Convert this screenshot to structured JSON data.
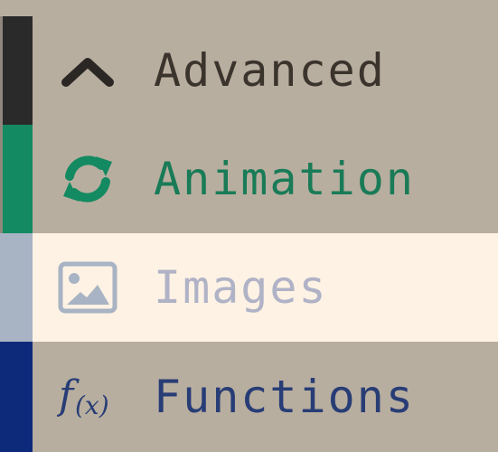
{
  "menu": {
    "items": [
      {
        "label": "Advanced",
        "icon": "chevron-up-icon",
        "accent_color": "#2a2a2a",
        "text_color": "#3b342d"
      },
      {
        "label": "Animation",
        "icon": "refresh-icon",
        "accent_color": "#138a61",
        "text_color": "#197b57"
      },
      {
        "label": "Images",
        "icon": "image-icon",
        "accent_color": "#a8b3c4",
        "text_color": "#b0b2c6",
        "state": "highlighted"
      },
      {
        "label": "Functions",
        "icon": "function-icon",
        "accent_color": "#0d2a7a",
        "text_color": "#283d76"
      }
    ]
  }
}
